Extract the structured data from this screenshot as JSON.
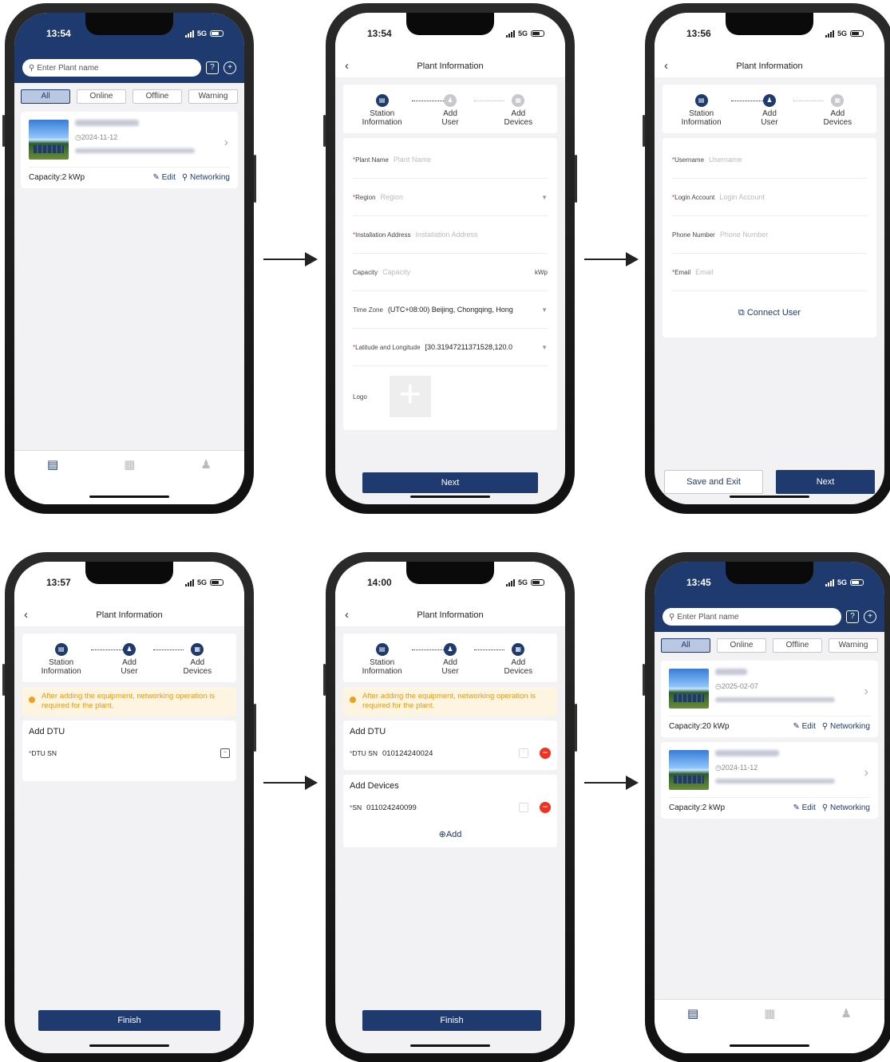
{
  "common": {
    "title": "Plant Information",
    "step_station": "Station",
    "step_station2": "Information",
    "step_user": "Add",
    "step_user2": "User",
    "step_devices": "Add",
    "step_devices2": "Devices",
    "network": "5G",
    "search_placeholder": "Enter Plant name",
    "filters": [
      "All",
      "Online",
      "Offline",
      "Warning"
    ]
  },
  "screen1": {
    "time": "13:54",
    "plant": {
      "date": "2024-11-12",
      "capacity": "Capacity:2 kWp",
      "edit": "Edit",
      "networking": "Networking"
    }
  },
  "screen2": {
    "time": "13:54",
    "fields": [
      {
        "label": "Plant Name",
        "required": true,
        "placeholder": "Plant Name"
      },
      {
        "label": "Region",
        "required": true,
        "placeholder": "Region"
      },
      {
        "label": "Installation Address",
        "required": true,
        "placeholder": "Installation Address"
      },
      {
        "label": "Capacity",
        "required": false,
        "placeholder": "Capacity",
        "unit": "kWp"
      },
      {
        "label": "Time Zone",
        "required": false,
        "value": "(UTC+08:00) Beijing, Chongqing, Hong"
      },
      {
        "label": "Latitude and Longitude",
        "required": true,
        "value": "[30.31947211371528,120.0"
      }
    ],
    "logo_label": "Logo",
    "next": "Next"
  },
  "screen3": {
    "time": "13:56",
    "fields": [
      {
        "label": "Username",
        "required": true,
        "placeholder": "Username"
      },
      {
        "label": "Login Account",
        "required": true,
        "placeholder": "Login Account"
      },
      {
        "label": "Phone Number",
        "required": false,
        "placeholder": "Phone Number"
      },
      {
        "label": "Email",
        "required": true,
        "placeholder": "Email"
      }
    ],
    "connect_user": "Connect User",
    "save_exit": "Save and Exit",
    "next": "Next"
  },
  "screen4": {
    "time": "13:57",
    "notice": "After adding the equipment, networking operation is required for the plant.",
    "add_dtu": "Add DTU",
    "dtu_label": "DTU SN",
    "finish": "Finish"
  },
  "screen5": {
    "time": "14:00",
    "notice": "After adding the equipment, networking operation is required for the plant.",
    "add_dtu": "Add DTU",
    "dtu_label": "DTU SN",
    "dtu_value": "010124240024",
    "add_devices": "Add Devices",
    "sn_label": "SN",
    "sn_value": "011024240099",
    "add": "Add",
    "finish": "Finish"
  },
  "screen6": {
    "time": "13:45",
    "plants": [
      {
        "date": "2025-02-07",
        "capacity": "Capacity:20 kWp",
        "edit": "Edit",
        "networking": "Networking"
      },
      {
        "date": "2024-11-12",
        "capacity": "Capacity:2 kWp",
        "edit": "Edit",
        "networking": "Networking"
      }
    ]
  }
}
